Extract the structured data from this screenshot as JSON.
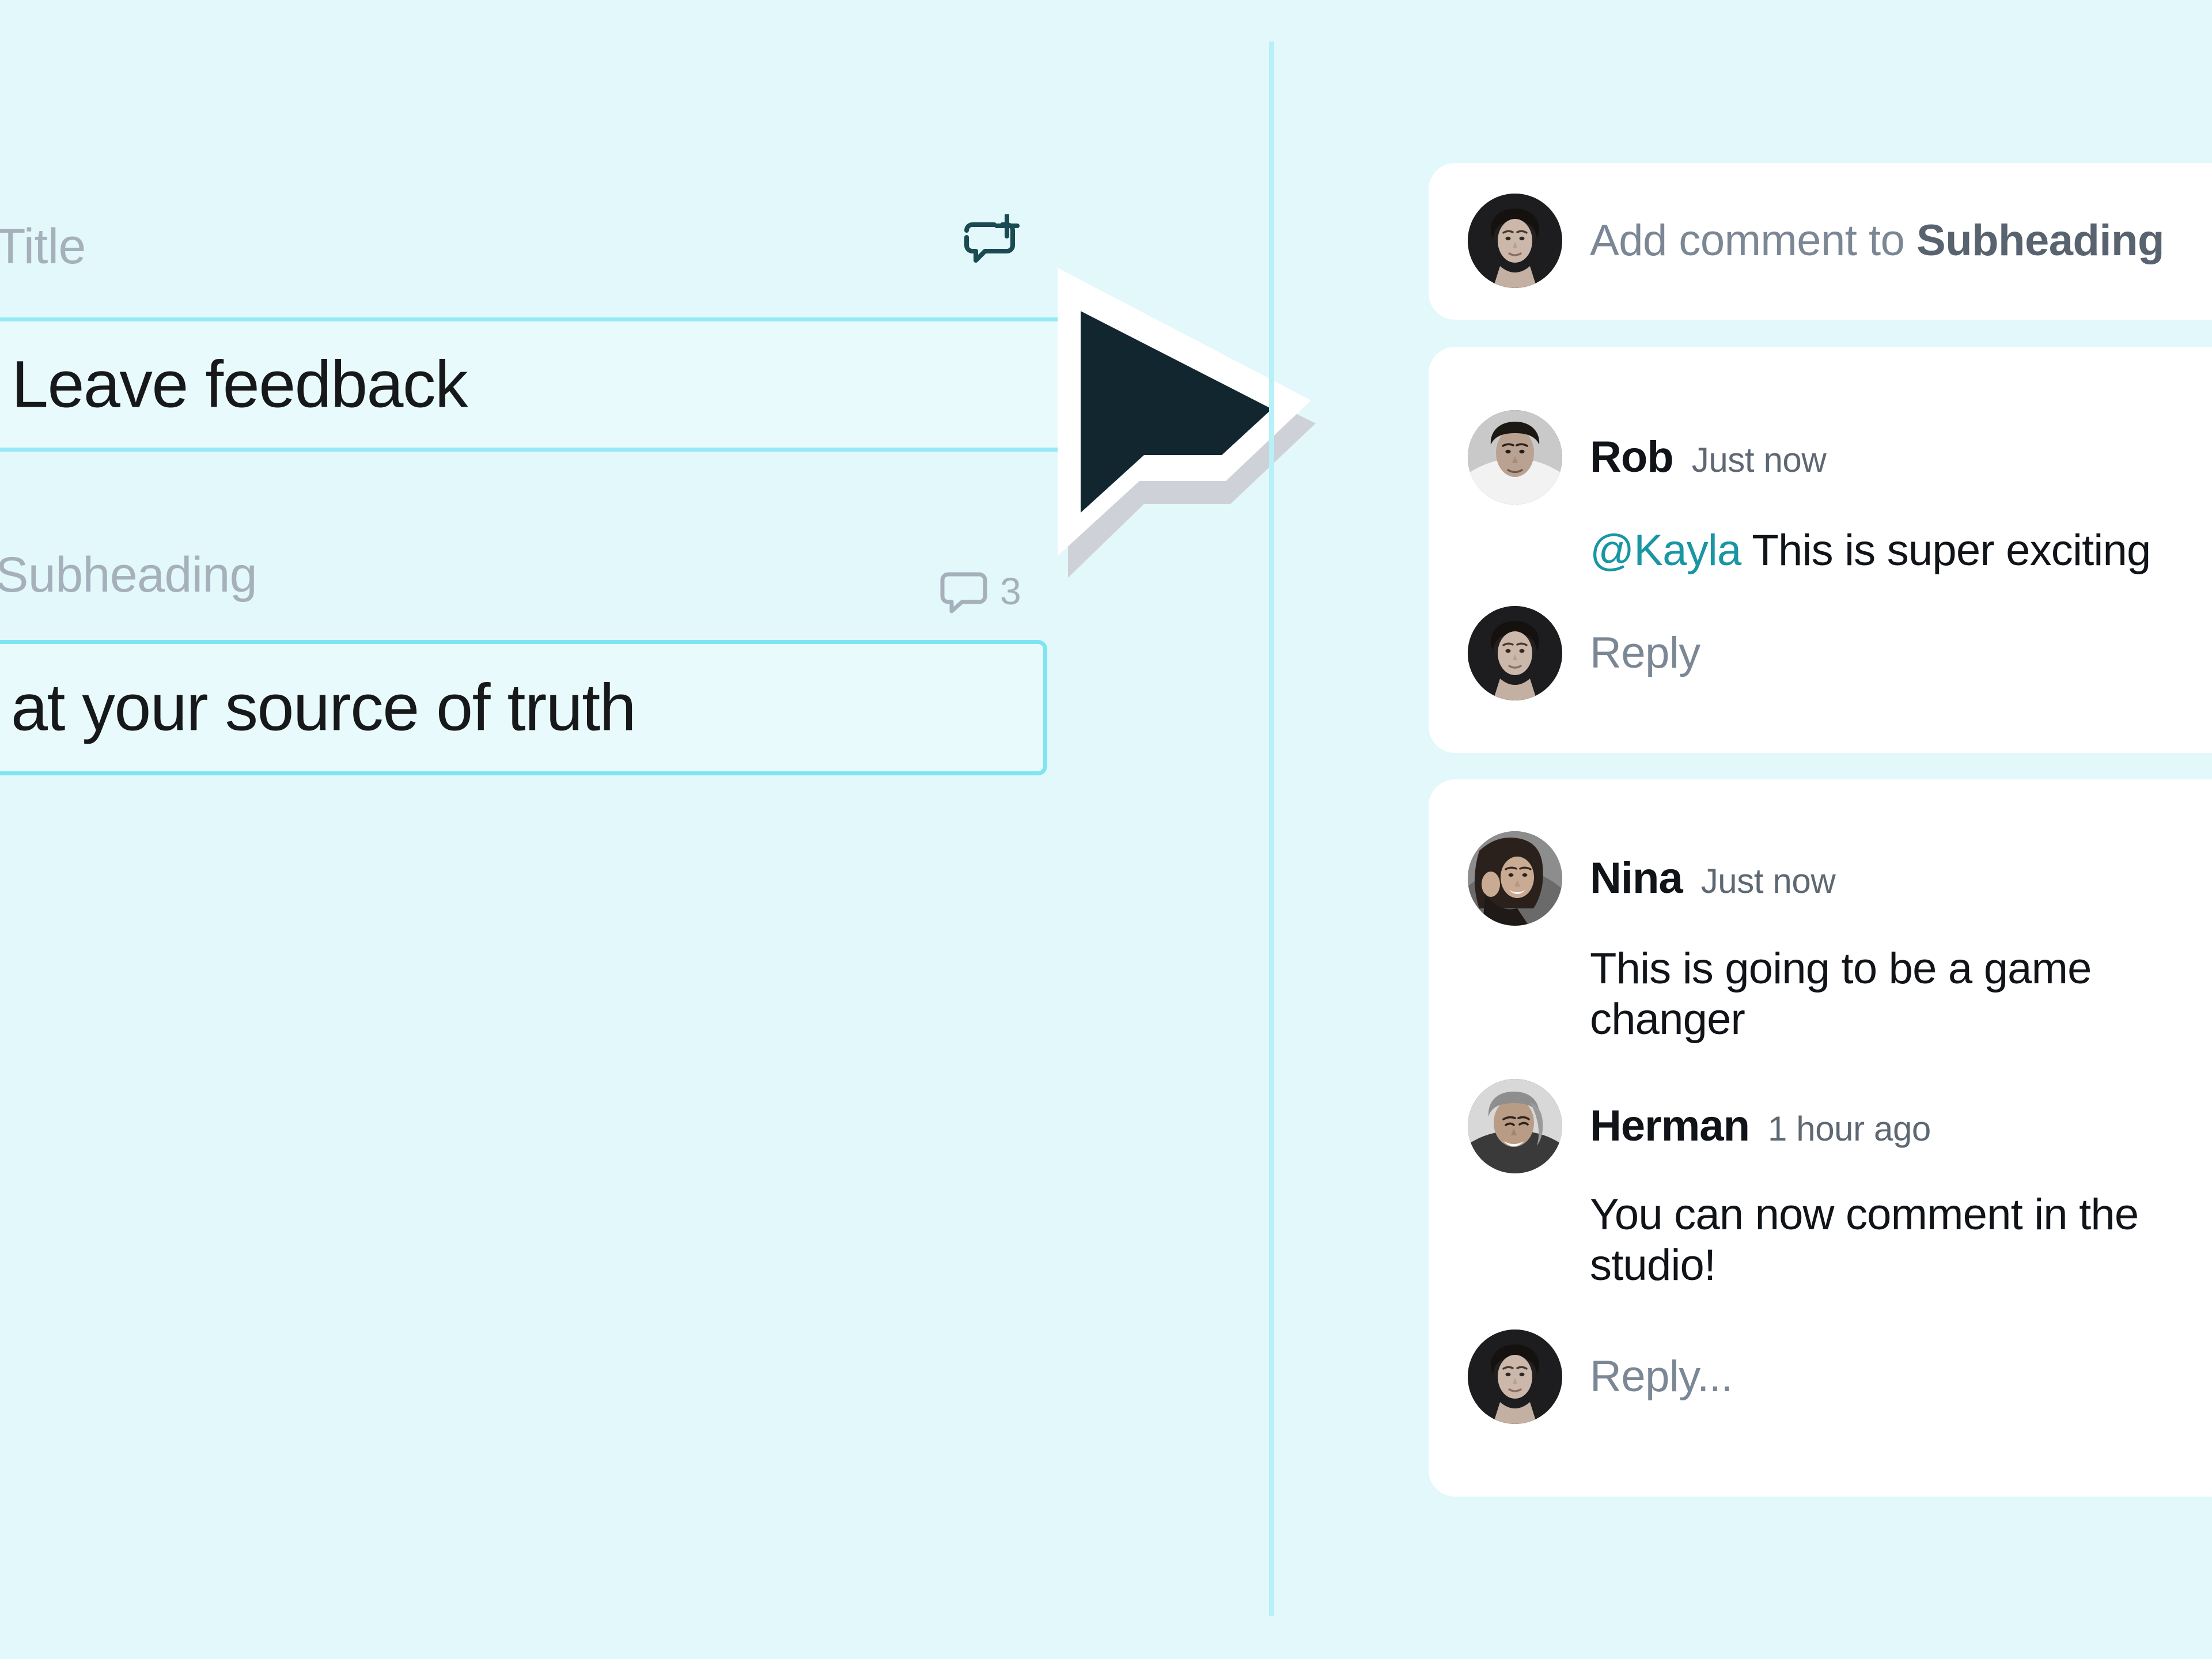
{
  "colors": {
    "canvas": "#e2f8fb",
    "field_bg": "#e8fafc",
    "field_border": "#7fe4f2",
    "divider": "#b7f0f9",
    "accent_teal": "#1a4a52",
    "mention_teal": "#1896a3",
    "card_bg": "#ffffff",
    "muted_text": "#a6b0bb",
    "secondary_text": "#7b8794"
  },
  "editor": {
    "title_field": {
      "label": "Title",
      "value": "Leave feedback"
    },
    "subheading_field": {
      "label": "Subheading",
      "value": "at your source of truth"
    },
    "add_comment_icon": "comment-plus-icon",
    "comment_indicator": {
      "icon": "comment-bubble-icon",
      "count": "3"
    },
    "cursor_icon": "mouse-pointer-arrow"
  },
  "comment_rail": {
    "compose": {
      "avatar": "avatar-kayla",
      "placeholder_prefix": "Add comment to ",
      "placeholder_target": "Subheading"
    },
    "threads": [
      {
        "comments": [
          {
            "avatar": "avatar-rob",
            "author": "Rob",
            "time": "Just now",
            "mention": "@Kayla",
            "text": " This is super exciting"
          }
        ],
        "reply": {
          "avatar": "avatar-kayla",
          "label": "Reply"
        }
      },
      {
        "comments": [
          {
            "avatar": "avatar-nina",
            "author": "Nina",
            "time": "Just now",
            "mention": "",
            "text": "This is going to be a game changer"
          },
          {
            "avatar": "avatar-herman",
            "author": "Herman",
            "time": "1 hour ago",
            "mention": "",
            "text": "You can now comment in the studio!"
          }
        ],
        "reply": {
          "avatar": "avatar-kayla",
          "label": "Reply..."
        }
      }
    ]
  }
}
